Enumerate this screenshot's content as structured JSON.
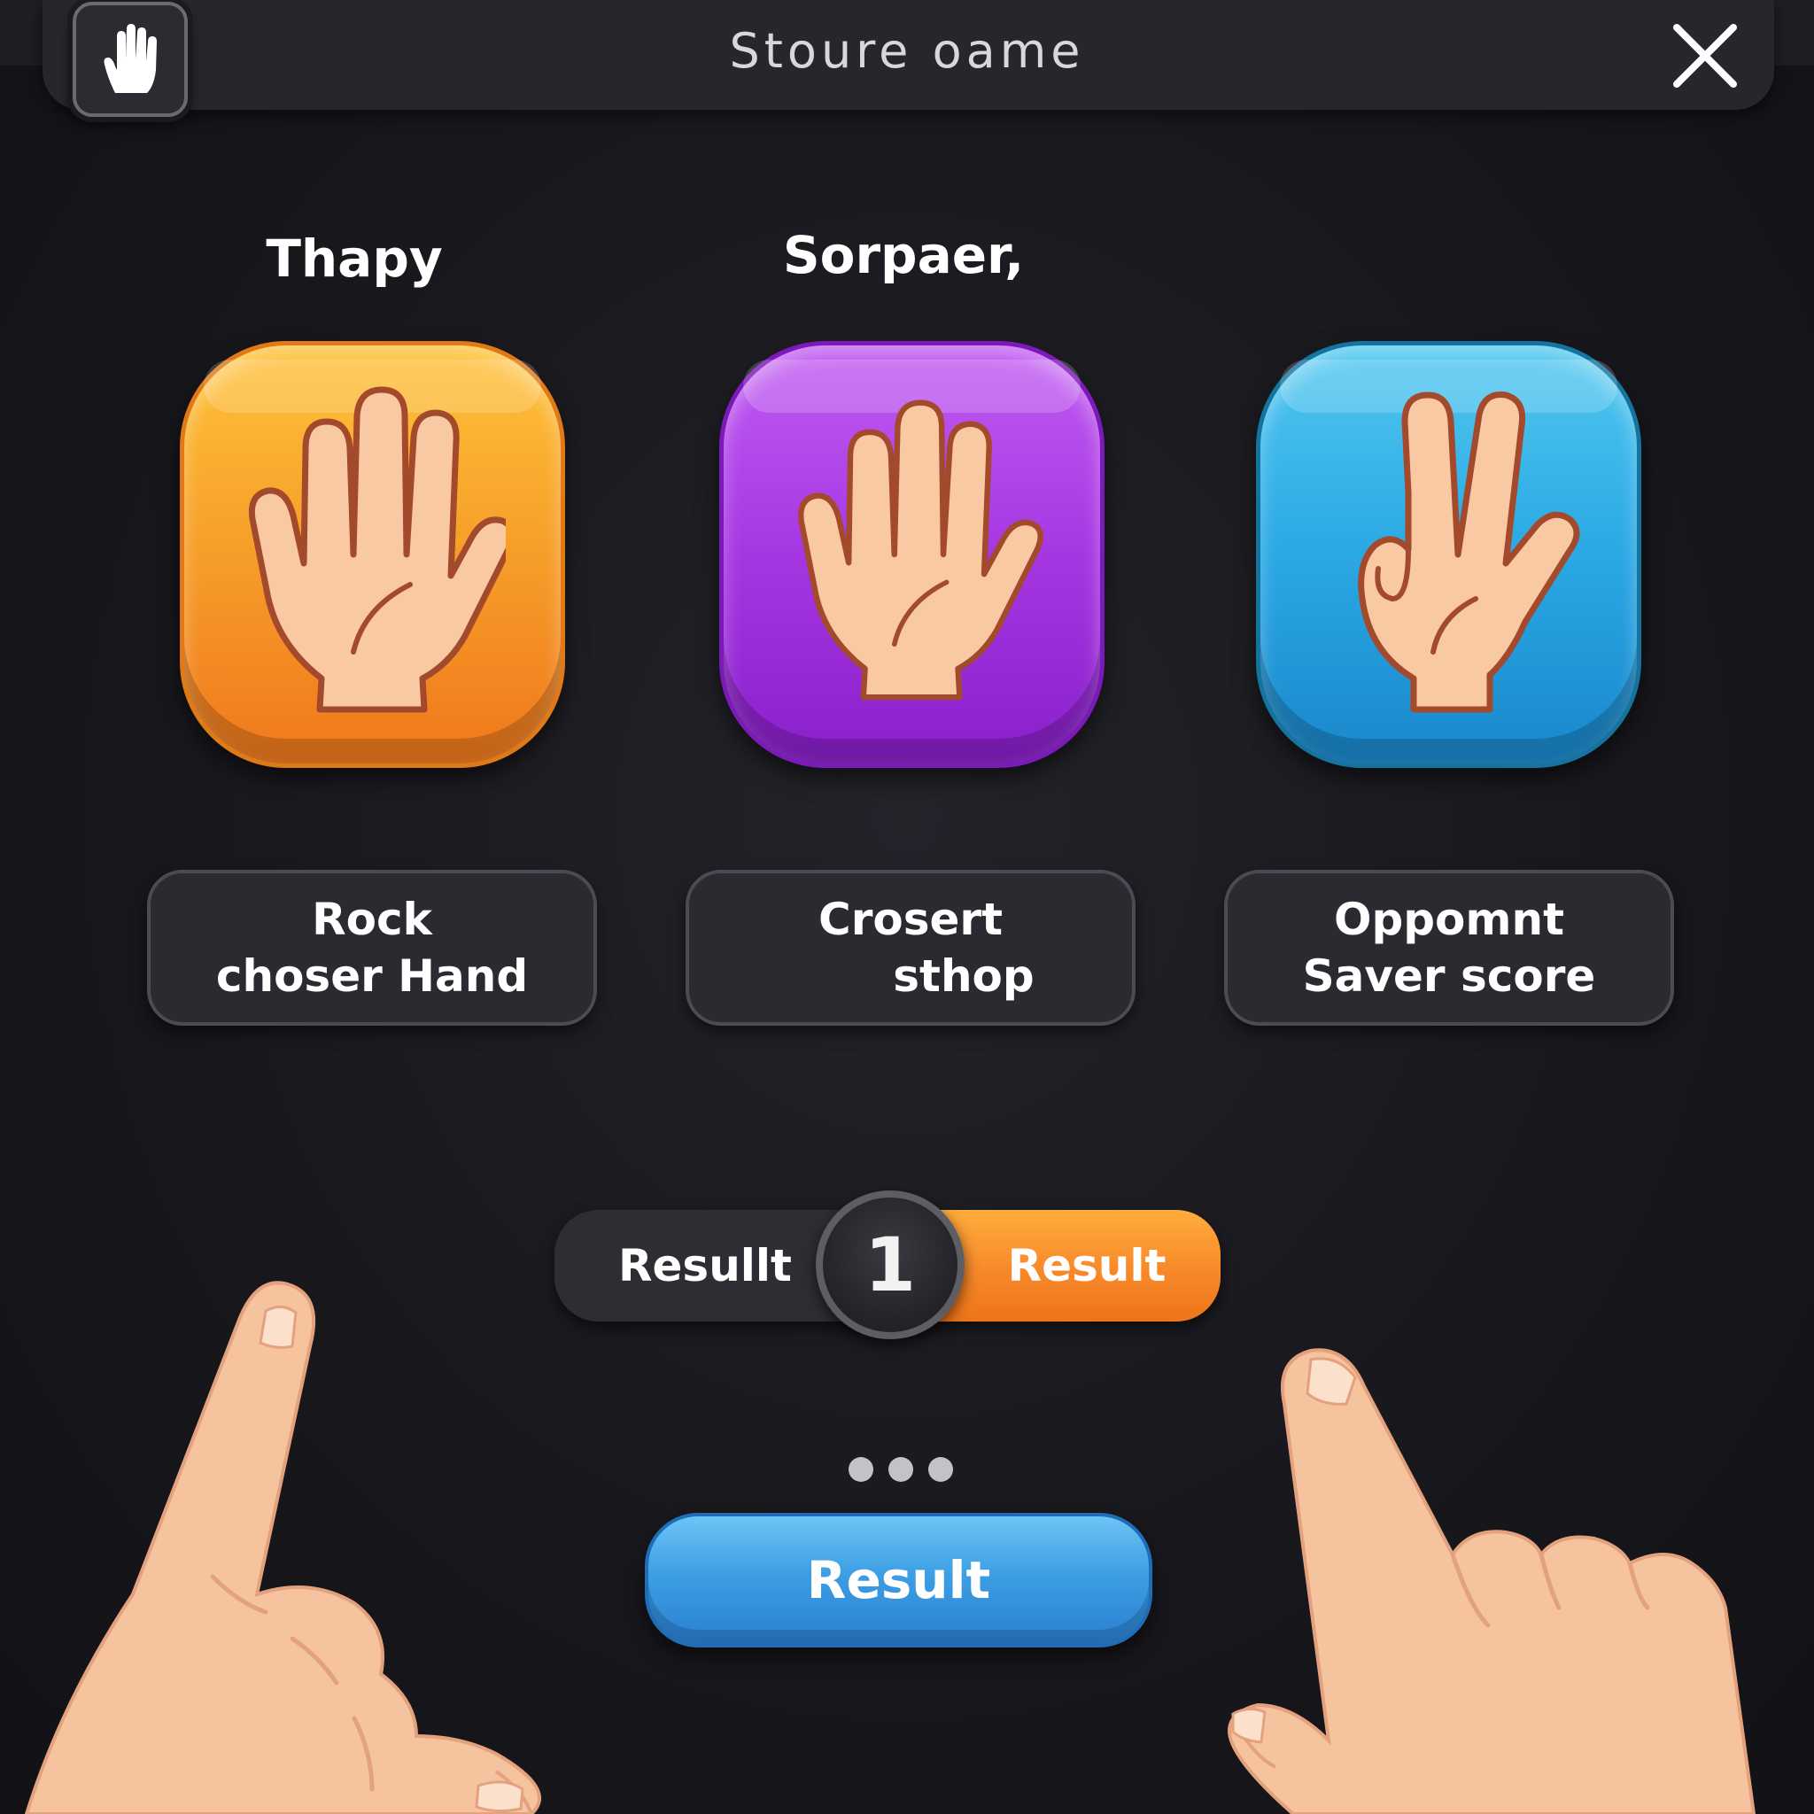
{
  "window": {
    "title": "Stoure oame",
    "left_icon": "hand-icon",
    "close_icon": "close-icon"
  },
  "headings": {
    "left": "Thapy",
    "center": "Sorpaer,"
  },
  "tiles": [
    {
      "name": "orange-hand-tile",
      "icon": "open-hand-icon",
      "color": "#f7a12a"
    },
    {
      "name": "purple-hand-tile",
      "icon": "open-hand-icon",
      "color": "#a537e2"
    },
    {
      "name": "blue-hand-tile",
      "icon": "scissors-hand-icon",
      "color": "#2aa8e4"
    }
  ],
  "info_boxes": [
    {
      "line1": "Rock",
      "line2": "choser Hand"
    },
    {
      "line1": "Crosert",
      "line2": "sthop"
    },
    {
      "line1": "Oppomnt",
      "line2": "Saver score"
    }
  ],
  "toggle": {
    "left_label": "Resullt",
    "knob_label": "1",
    "right_label": "Result",
    "accent": "#f7892a"
  },
  "result_button": {
    "label": "Result",
    "color": "#3d9fe4"
  },
  "decorations": {
    "left_hand": "pointing-hand-left-icon",
    "right_hand": "pointing-hand-right-icon"
  }
}
